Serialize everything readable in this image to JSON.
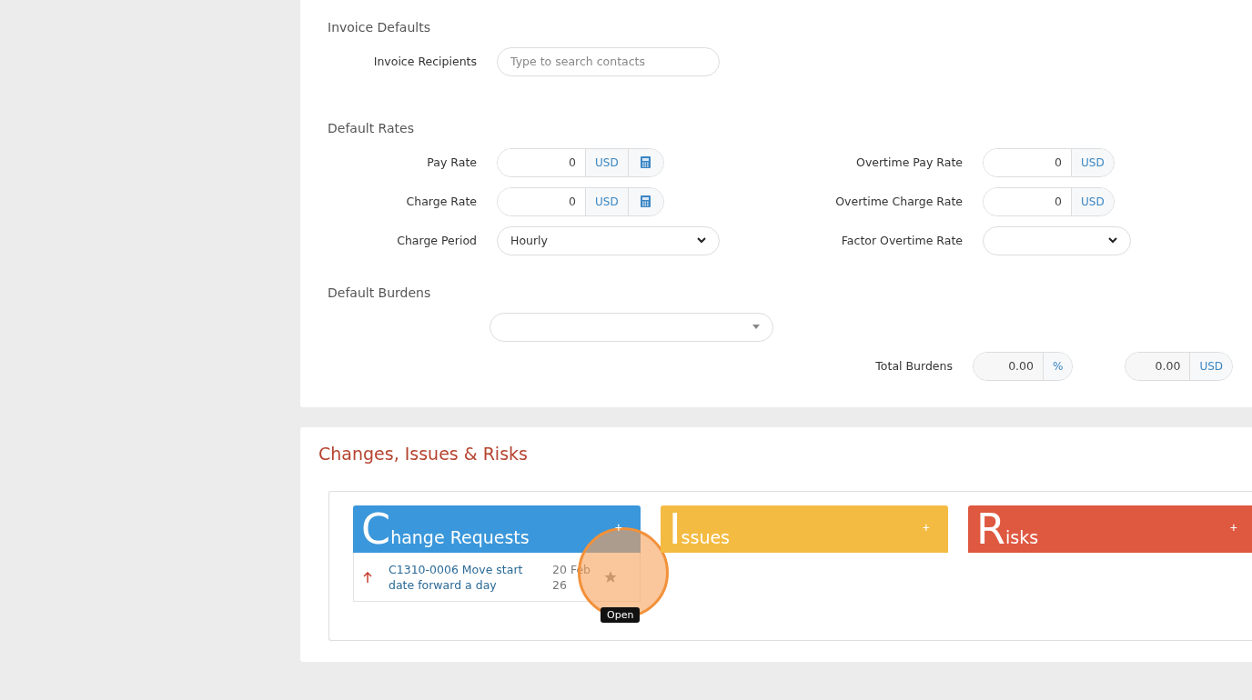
{
  "invoice_defaults": {
    "title": "Invoice Defaults",
    "recipients": {
      "label": "Invoice Recipients",
      "placeholder": "Type to search contacts"
    }
  },
  "default_rates": {
    "title": "Default Rates",
    "left": [
      {
        "kind": "money",
        "label": "Pay Rate",
        "value": "0",
        "unit": "USD",
        "calculator": true
      },
      {
        "kind": "money",
        "label": "Charge Rate",
        "value": "0",
        "unit": "USD",
        "calculator": true
      },
      {
        "kind": "select",
        "label": "Charge Period",
        "value": "Hourly"
      }
    ],
    "right": [
      {
        "kind": "money",
        "label": "Overtime Pay Rate",
        "value": "0",
        "unit": "USD",
        "calculator": false
      },
      {
        "kind": "money",
        "label": "Overtime Charge Rate",
        "value": "0",
        "unit": "USD",
        "calculator": false
      },
      {
        "kind": "select",
        "label": "Factor Overtime Rate"
      }
    ]
  },
  "default_burdens": {
    "title": "Default Burdens",
    "total_label": "Total Burdens",
    "percent": {
      "value": "0.00",
      "unit": "%"
    },
    "amount": {
      "value": "0.00",
      "unit": "USD"
    }
  },
  "cir": {
    "title": "Changes, Issues & Risks",
    "lanes": [
      {
        "initial": "C",
        "rest": "hange Requests",
        "add": "+",
        "color": "#3a97db",
        "items": [
          {
            "title": "C1310-0006 Move start date forward a day",
            "date": "20 Feb 26",
            "tooltip": "Open"
          }
        ]
      },
      {
        "initial": "I",
        "rest": "ssues",
        "add": "+",
        "color": "#f4bb42"
      },
      {
        "initial": "R",
        "rest": "isks",
        "add": "+",
        "color": "#df5840"
      }
    ]
  }
}
